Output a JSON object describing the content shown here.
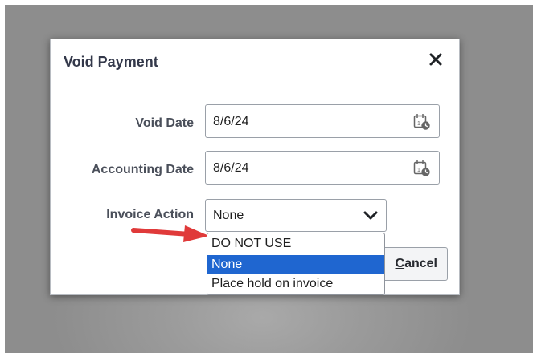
{
  "dialog": {
    "title": "Void Payment",
    "close_icon": "close-icon"
  },
  "fields": {
    "void_date": {
      "label": "Void Date",
      "value": "8/6/24",
      "icon": "calendar-icon"
    },
    "accounting_date": {
      "label": "Accounting Date",
      "value": "8/6/24",
      "icon": "calendar-icon"
    },
    "invoice_action": {
      "label": "Invoice Action",
      "value": "None",
      "icon": "chevron-down-icon",
      "options": [
        "DO NOT USE",
        "None",
        "Place hold on invoice"
      ],
      "highlighted_option": "None"
    }
  },
  "buttons": {
    "cancel_mnemonic": "C",
    "cancel_rest": "ancel"
  },
  "annotation": {
    "arrow_color": "#e03a3a"
  },
  "colors": {
    "selection": "#1f66d0",
    "title_text": "#33384a"
  }
}
